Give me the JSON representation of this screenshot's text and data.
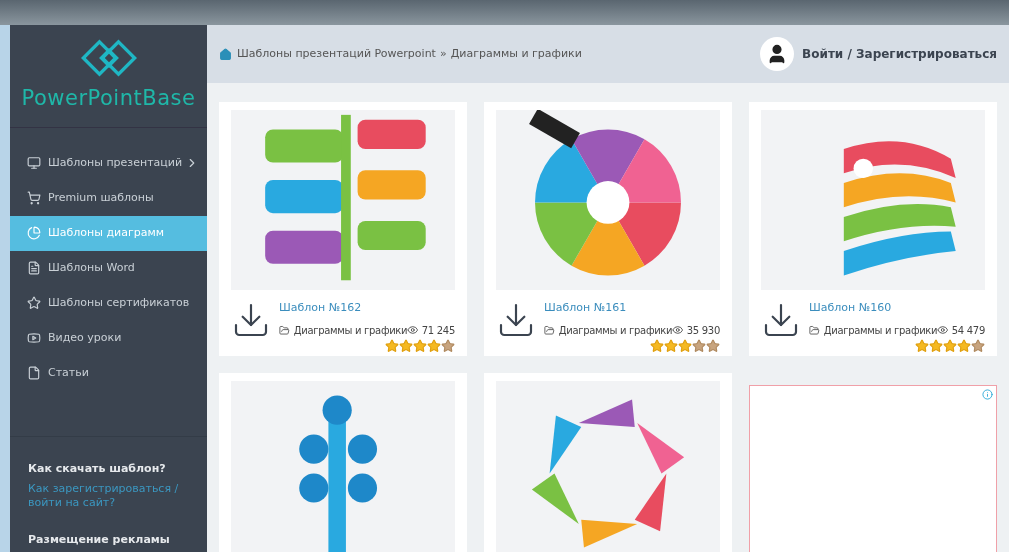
{
  "sidebar": {
    "logo": "PowerPointBase",
    "items": [
      {
        "label": "Шаблоны презентаций",
        "has_submenu": true,
        "selected": false
      },
      {
        "label": "Premium шаблоны",
        "has_submenu": false,
        "selected": false
      },
      {
        "label": "Шаблоны диаграмм",
        "has_submenu": false,
        "selected": true
      },
      {
        "label": "Шаблоны Word",
        "has_submenu": false,
        "selected": false
      },
      {
        "label": "Шаблоны сертификатов",
        "has_submenu": false,
        "selected": false
      },
      {
        "label": "Видео уроки",
        "has_submenu": false,
        "selected": false
      },
      {
        "label": "Статьи",
        "has_submenu": false,
        "selected": false
      }
    ],
    "help_title": "Как скачать шаблон?",
    "help_link": "Как зарегистрироваться / войти на сайт?",
    "ads_title": "Размещение рекламы"
  },
  "breadcrumb": [
    "Шаблоны презентаций Powerpoint",
    "»",
    "Диаграммы и графики"
  ],
  "login": "Войти / Зарегистрироваться",
  "cards": [
    {
      "kind": "template",
      "title": "Шаблон №162",
      "category": "Диаграммы и графики",
      "views": "71 245",
      "stars": 4
    },
    {
      "kind": "template",
      "title": "Шаблон №161",
      "category": "Диаграммы и графики",
      "views": "35 930",
      "stars": 3
    },
    {
      "kind": "template",
      "title": "Шаблон №160",
      "category": "Диаграммы и графики",
      "views": "54 479",
      "stars": 4
    },
    {
      "kind": "preview"
    },
    {
      "kind": "preview"
    },
    {
      "kind": "ad"
    }
  ]
}
